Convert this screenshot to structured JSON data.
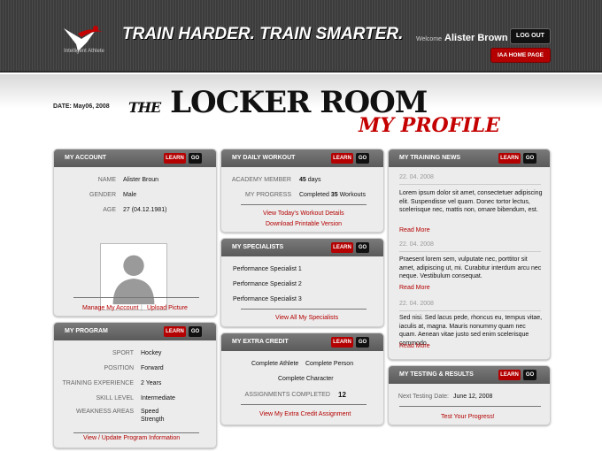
{
  "header": {
    "logo_text": "Intelligent Athlete",
    "tagline": "TRAIN HARDER. TRAIN SMARTER.",
    "welcome_label": "Welcome",
    "user_name": "Alister Brown",
    "logout_label": "LOG OUT",
    "home_label": "IAA HOME PAGE"
  },
  "page": {
    "date": "DATE: May06, 2008",
    "title_the": "THE",
    "title_main": "LOCKER ROOM",
    "subtitle": "MY PROFILE"
  },
  "buttons": {
    "learn": "LEARN",
    "go": "GO"
  },
  "account": {
    "title": "MY ACCOUNT",
    "name_label": "NAME",
    "name": "Alister Broun",
    "gender_label": "GENDER",
    "gender": "Male",
    "age_label": "AGE",
    "age": "27  (04.12.1981)",
    "manage": "Manage My Account",
    "divider": "|",
    "upload": "Upload Picture"
  },
  "program": {
    "title": "MY PROGRAM",
    "sport_label": "SPORT",
    "sport": "Hockey",
    "position_label": "POSITION",
    "position": "Forward",
    "exp_label": "TRAINING EXPERIENCE",
    "exp": "2 Years",
    "skill_label": "SKILL LEVEL",
    "skill": "Intermediate",
    "weak_label": "WEAKNESS AREAS",
    "weak1": "Speed",
    "weak2": "Strength",
    "link": "View / Update Program Information"
  },
  "workout": {
    "title": "MY DAILY WORKOUT",
    "member_label": "ACADEMY MEMBER",
    "member_num": "45",
    "member_unit": "days",
    "progress_label": "MY PROGRESS",
    "progress_pre": "Completed",
    "progress_num": "35",
    "progress_post": "Workouts",
    "link1": "View Today's Workout Details",
    "link2": "Download Printable Version"
  },
  "specialists": {
    "title": "MY SPECIALISTS",
    "items": [
      "Performance Specialist 1",
      "Performance Specialist 2",
      "Performance Specialist 3"
    ],
    "link": "View All My Specialists"
  },
  "credit": {
    "title": "MY EXTRA CREDIT",
    "item1": "Complete Athlete",
    "item2": "Complete Person",
    "item3": "Complete Character",
    "assign_label": "ASSIGNMENTS COMPLETED",
    "assign_val": "12",
    "link": "View My Extra Credit Assignment"
  },
  "news": {
    "title": "MY TRAINING NEWS",
    "items": [
      {
        "date": "22. 04. 2008",
        "text": "Lorem ipsum dolor sit amet, consectetuer adipiscing elit. Suspendisse vel quam. Donec tortor lectus, scelerisque nec, mattis non, ornare bibendum, est.",
        "more": "Read More"
      },
      {
        "date": "22. 04. 2008",
        "text": "Praesent lorem sem, vulputate nec, porttitor sit amet, adipiscing ut, mi. Curabitur interdum arcu nec neque. Vestibulum consequat.",
        "more": "Read More"
      },
      {
        "date": "22. 04. 2008",
        "text": "Sed nisi. Sed lacus pede, rhoncus eu, tempus vitae, iaculis at, magna. Mauris nonummy quam nec quam. Aenean vitae justo sed enim scelerisque commodo.",
        "more": "Read More"
      }
    ]
  },
  "testing": {
    "title": "MY TESTING & RESULTS",
    "next_label": "Next Testing Date:",
    "next_date": "June 12, 2008",
    "link": "Test Your Progress!"
  }
}
